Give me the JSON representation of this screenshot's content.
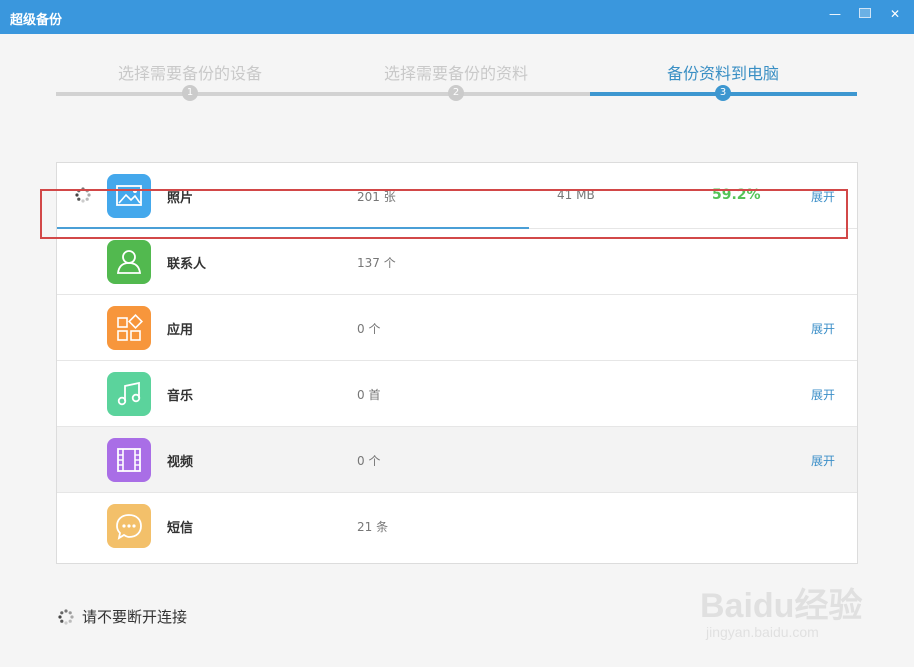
{
  "window": {
    "title": "超级备份"
  },
  "steps": [
    {
      "number": "1",
      "label": "选择需要备份的设备"
    },
    {
      "number": "2",
      "label": "选择需要备份的资料"
    },
    {
      "number": "3",
      "label": "备份资料到电脑"
    }
  ],
  "items": [
    {
      "name": "照片",
      "count": "201 张",
      "size": "41 MB",
      "percent": "59.2%",
      "expand": "展开",
      "icon": "photo-icon",
      "color": "#44a8ec"
    },
    {
      "name": "联系人",
      "count": "137 个",
      "icon": "contact-icon",
      "color": "#52b94f"
    },
    {
      "name": "应用",
      "count": "0 个",
      "expand": "展开",
      "icon": "apps-icon",
      "color": "#f7963c"
    },
    {
      "name": "音乐",
      "count": "0 首",
      "expand": "展开",
      "icon": "music-icon",
      "color": "#5bd39c"
    },
    {
      "name": "视频",
      "count": "0 个",
      "expand": "展开",
      "icon": "video-icon",
      "color": "#a96ee6"
    },
    {
      "name": "短信",
      "count": "21 条",
      "icon": "sms-icon",
      "color": "#f3c06a"
    }
  ],
  "footer": {
    "status": "请不要断开连接"
  },
  "watermark": {
    "logo": "Baidu经验",
    "url": "jingyan.baidu.com"
  }
}
